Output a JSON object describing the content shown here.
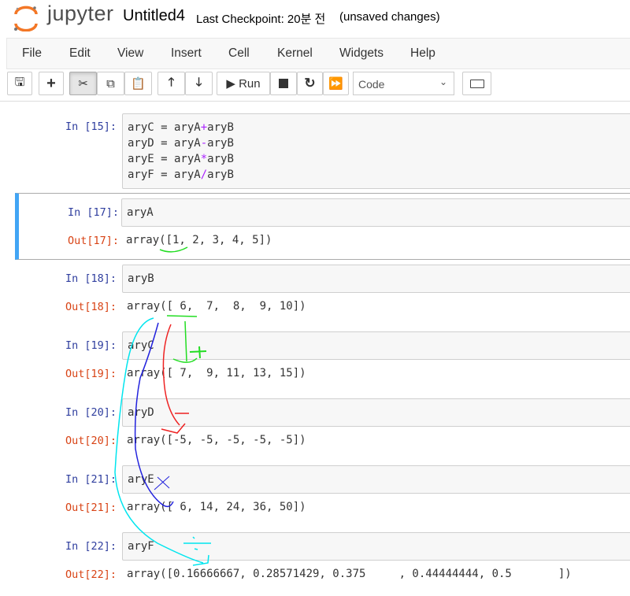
{
  "header": {
    "logo_text": "jupyter",
    "notebook_title": "Untitled4",
    "checkpoint": "Last Checkpoint: 20분 전",
    "status": "(unsaved changes)"
  },
  "menu": [
    "File",
    "Edit",
    "View",
    "Insert",
    "Cell",
    "Kernel",
    "Widgets",
    "Help"
  ],
  "toolbar": {
    "run_label": "Run",
    "cell_type": "Code",
    "icons": [
      "save-icon",
      "plus-icon",
      "scissors-icon",
      "copy-icon",
      "paste-icon",
      "arrow-up-icon",
      "arrow-down-icon",
      "play-icon",
      "stop-icon",
      "restart-icon",
      "fast-forward-icon",
      "keyboard-icon"
    ]
  },
  "colors": {
    "selected_bar": "#42a5f5",
    "in_prompt": "#303f9f",
    "out_prompt": "#d84315",
    "operator": "#aa22ff"
  },
  "cells": [
    {
      "in": "In [15]:",
      "code": [
        [
          "aryC = aryA",
          "+",
          "aryB"
        ],
        [
          "aryD = aryA",
          "-",
          "aryB"
        ],
        [
          "aryE = aryA",
          "*",
          "aryB"
        ],
        [
          "aryF = aryA",
          "/",
          "aryB"
        ]
      ],
      "out_label": null,
      "out": null
    },
    {
      "in": "In [17]:",
      "code": [
        [
          "aryA"
        ]
      ],
      "out_label": "Out[17]:",
      "out": "array([1, 2, 3, 4, 5])",
      "selected": true
    },
    {
      "in": "In [18]:",
      "code": [
        [
          "aryB"
        ]
      ],
      "out_label": "Out[18]:",
      "out": "array([ 6,  7,  8,  9, 10])"
    },
    {
      "in": "In [19]:",
      "code": [
        [
          "aryC"
        ]
      ],
      "out_label": "Out[19]:",
      "out": "array([ 7,  9, 11, 13, 15])"
    },
    {
      "in": "In [20]:",
      "code": [
        [
          "aryD"
        ]
      ],
      "out_label": "Out[20]:",
      "out": "array([-5, -5, -5, -5, -5])"
    },
    {
      "in": "In [21]:",
      "code": [
        [
          "aryE"
        ]
      ],
      "out_label": "Out[21]:",
      "out": "array([ 6, 14, 24, 36, 50])"
    },
    {
      "in": "In [22]:",
      "code": [
        [
          "aryF"
        ]
      ],
      "out_label": "Out[22]:",
      "out": "array([0.16666667, 0.28571429, 0.375     , 0.44444444, 0.5       ])"
    }
  ]
}
